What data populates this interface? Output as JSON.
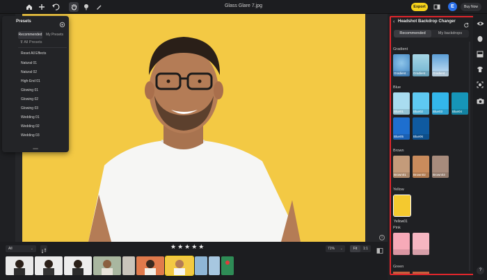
{
  "window": {
    "title": "Glass Glare 7.jpg"
  },
  "topbar": {
    "export_label": "Export",
    "avatar_initial": "E",
    "buy_label": "Buy Now"
  },
  "presets_panel": {
    "title": "Presets",
    "tabs": [
      "Recommended",
      "My Presets"
    ],
    "filter_label": "All Presets",
    "items": [
      "Reset All Effects",
      "Natural 01",
      "Natural 02",
      "High-End 01",
      "Glowing 01",
      "Glowing 02",
      "Glowing 03",
      "Wedding 01",
      "Wedding 02",
      "Wedding 03"
    ]
  },
  "bottom": {
    "filter_value": "All",
    "zoom": "71%",
    "fit_label": "Fit",
    "ratio_label": "1:1",
    "rating_stars": "★★★★★"
  },
  "right_panel": {
    "title": "Headshot Backdrop Changer",
    "tabs": [
      "Recommended",
      "My backdrops"
    ],
    "sections": {
      "gradient": {
        "label": "Gradient",
        "items": [
          "Gradient...",
          "Gradient...",
          "Gradient..."
        ]
      },
      "blue": {
        "label": "Blue",
        "items": [
          "Blue01",
          "Blue02",
          "Blue03",
          "Blue04",
          "Blue05",
          "Blue06"
        ]
      },
      "brown": {
        "label": "Brown",
        "items": [
          "Brown01",
          "Brown02",
          "Brown03"
        ]
      },
      "yellow": {
        "label": "Yellow",
        "items": [
          "Yellow01"
        ]
      },
      "pink": {
        "label": "Pink",
        "items": [
          "",
          ""
        ]
      },
      "green": {
        "label": "Green"
      }
    }
  },
  "colors": {
    "accent_yellow": "#f5d21a",
    "background_yellow": "#f3c944",
    "highlight_red": "#e1262c"
  }
}
